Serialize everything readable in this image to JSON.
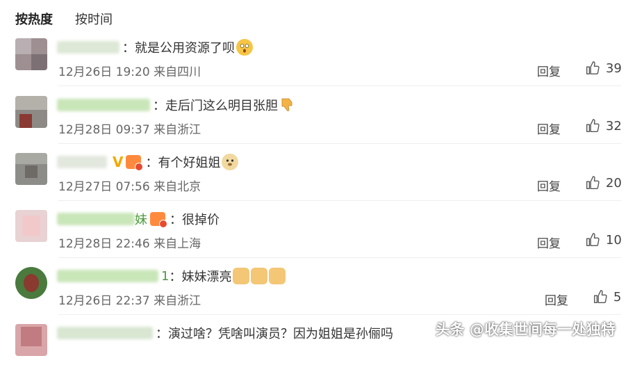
{
  "tabs": [
    {
      "label": "按热度",
      "active": true
    },
    {
      "label": "按时间",
      "active": false
    }
  ],
  "reply_label": "回复",
  "comments": [
    {
      "text": "：就是公用资源了呗",
      "emoji": "shocked-face-emoji",
      "time": "12月26日 19:20",
      "location": "来自四川",
      "likes": "39"
    },
    {
      "text": "：走后门这么明目张胆",
      "emoji": "thumbs-down-emoji",
      "time": "12月28日 09:37",
      "location": "来自浙江",
      "likes": "32"
    },
    {
      "text": "：有个好姐姐",
      "emoji": "doge-emoji",
      "time": "12月27日 07:56",
      "location": "来自北京",
      "likes": "20"
    },
    {
      "name_visible": "妹",
      "text": "：很掉价",
      "time": "12月28日 22:46",
      "location": "来自上海",
      "likes": "10"
    },
    {
      "name_visible": "1",
      "text": "：妹妹漂亮",
      "emoji": "thumbs-up-emoji",
      "time": "12月26日 22:37",
      "location": "来自浙江",
      "likes": "5"
    },
    {
      "text": "：演过啥？凭啥叫演员？因为姐姐是孙俪吗"
    }
  ],
  "watermark": "头条 @收集世间每一处独特",
  "colors": {
    "meta_text": "#666666",
    "badge_gold": "#f2a900",
    "emoji_yellow": "#f7c545",
    "name_blur_green": "#c9e6b9"
  }
}
